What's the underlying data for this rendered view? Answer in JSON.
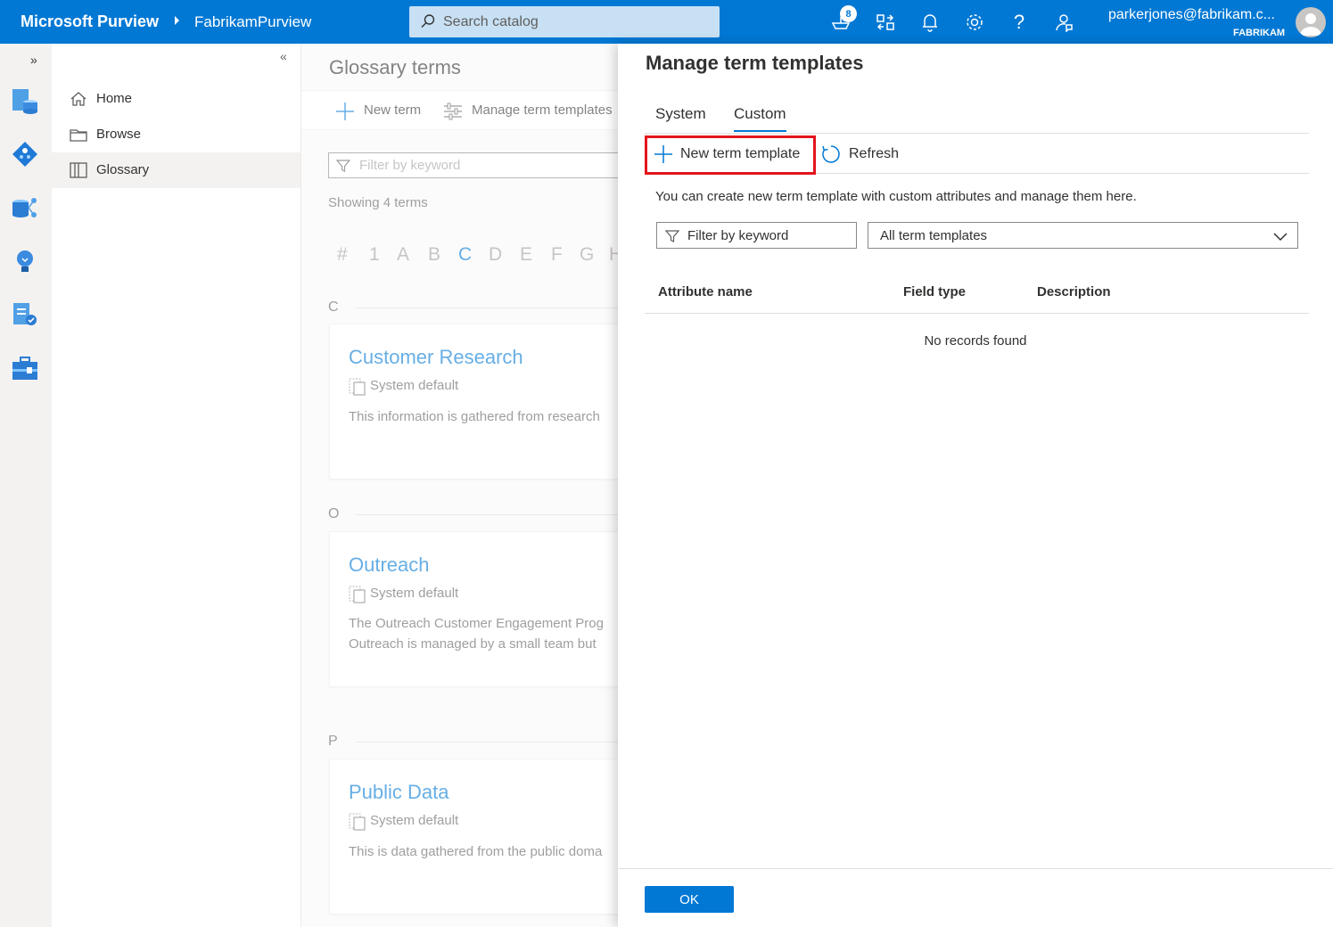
{
  "topbar": {
    "brand": "Microsoft Purview",
    "account": "FabrikamPurview",
    "search_placeholder": "Search catalog",
    "notification_count": "8",
    "user_email": "parkerjones@fabrikam.c...",
    "user_tenant": "FABRIKAM"
  },
  "rail": {
    "expand": "»"
  },
  "nav": {
    "collapse": "«",
    "items": [
      {
        "label": "Home",
        "icon": "home-icon"
      },
      {
        "label": "Browse",
        "icon": "folder-icon"
      },
      {
        "label": "Glossary",
        "icon": "book-icon"
      }
    ]
  },
  "main": {
    "title": "Glossary terms",
    "new_term": "New term",
    "manage_templates": "Manage term templates",
    "filter_placeholder": "Filter by keyword",
    "showing": "Showing 4 terms",
    "alphabet": [
      "#",
      "1",
      "A",
      "B",
      "C",
      "D",
      "E",
      "F",
      "G",
      "H"
    ],
    "selected_letter": "C",
    "sections": [
      {
        "letter": "C",
        "term": "Customer Research",
        "meta": "System default",
        "desc": [
          "This information is gathered from research"
        ]
      },
      {
        "letter": "O",
        "term": "Outreach",
        "meta": "System default",
        "desc": [
          "The Outreach Customer Engagement Prog",
          "Outreach is managed by a small team but"
        ]
      },
      {
        "letter": "P",
        "term": "Public Data",
        "meta": "System default",
        "desc": [
          "This is data gathered from the public doma"
        ]
      }
    ]
  },
  "panel": {
    "title": "Manage term templates",
    "tabs": [
      "System",
      "Custom"
    ],
    "active_tab": "Custom",
    "new_template": "New term template",
    "refresh": "Refresh",
    "hint": "You can create new term template with custom attributes and manage them here.",
    "filter_placeholder": "Filter by keyword",
    "select_value": "All term templates",
    "columns": [
      "Attribute name",
      "Field type",
      "Description"
    ],
    "empty": "No records found",
    "ok": "OK"
  },
  "colors": {
    "brand": "#0078d4",
    "highlight": "#e3141c"
  }
}
